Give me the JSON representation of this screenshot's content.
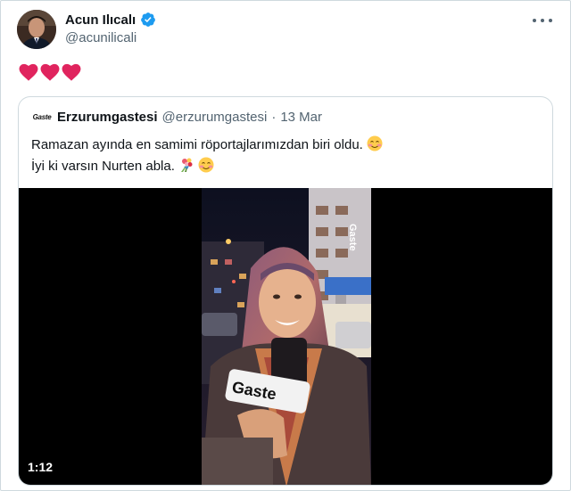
{
  "author": {
    "display_name": "Acun Ilıcalı",
    "handle": "@acunilicali",
    "verified_icon": "verified-badge-icon",
    "verified_color": "#1d9bf0"
  },
  "tweet": {
    "hearts": [
      "❤️",
      "❤️",
      "❤️"
    ],
    "heart_color": "#e0245e"
  },
  "quoted": {
    "logo_text": "Gaste",
    "display_name": "Erzurumgastesi",
    "handle": "@erzurumgastesi",
    "separator": "·",
    "date": "13 Mar",
    "line1": "Ramazan ayında en samimi röportajlarımızdan biri oldu.",
    "line2": "İyi ki varsın Nurten abla.",
    "line1_emoji": "☺️",
    "line2_emojis": [
      "💐",
      "☺️"
    ],
    "video": {
      "duration": "1:12",
      "mic_brand": "Gaste",
      "building_sign": "Gaste"
    }
  },
  "colors": {
    "text": "#0f1419",
    "muted": "#536471",
    "border": "#cfd9de"
  }
}
